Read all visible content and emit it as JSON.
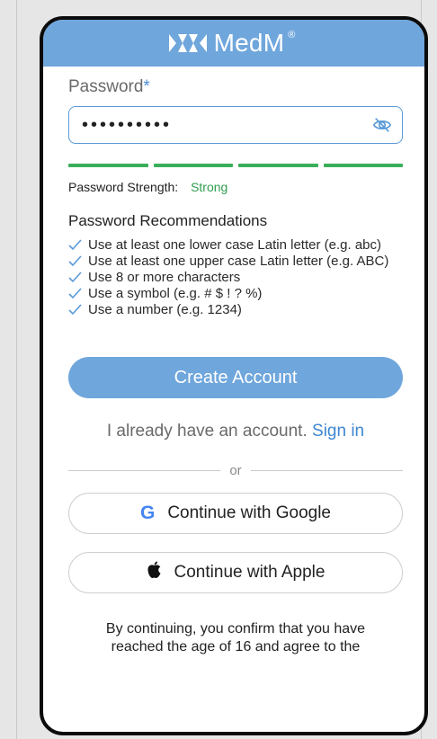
{
  "header": {
    "brand": "MedM",
    "reg": "®"
  },
  "form": {
    "password_label": "Password",
    "required_marker": "*",
    "password_value": "••••••••••",
    "strength_label": "Password Strength:",
    "strength_value": "Strong",
    "recommendations_title": "Password Recommendations",
    "recommendations": [
      "Use at least one lower case Latin letter (e.g. abc)",
      "Use at least one upper case Latin letter (e.g. ABC)",
      "Use 8 or more characters",
      "Use a symbol (e.g. # $ ! ? %)",
      "Use a number (e.g. 1234)"
    ],
    "create_label": "Create Account"
  },
  "signin": {
    "text": "I already have an account.",
    "link": "Sign in"
  },
  "divider": {
    "label": "or"
  },
  "social": {
    "google_label": "Continue with Google",
    "google_icon": "G",
    "apple_label": "Continue with Apple"
  },
  "legal": {
    "line1": "By continuing, you confirm that you have",
    "line2": "reached the age of 16 and agree to the"
  },
  "colors": {
    "accent": "#6fa6dc",
    "link": "#3f86d2",
    "strong": "#2f9e4f",
    "check": "#5b9ad8"
  }
}
